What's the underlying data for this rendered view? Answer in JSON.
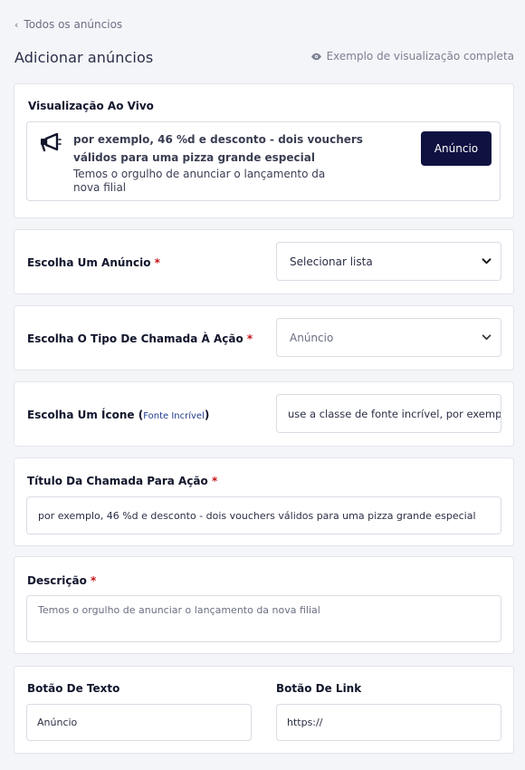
{
  "nav": {
    "back_label": "Todos os anúncios"
  },
  "header": {
    "title": "Adicionar anúncios",
    "preview_link": "Exemplo de visualização completa"
  },
  "live_preview": {
    "title": "Visualização Ao Vivo",
    "headline": "por exemplo, 46 %d e desconto - dois vouchers válidos para uma pizza grande especial",
    "description": "Temos o orgulho de anunciar o lançamento da nova filial",
    "button_label": "Anúncio"
  },
  "form": {
    "required_mark": "*",
    "announcement": {
      "label": "Escolha Um Anúncio",
      "value": "Selecionar lista"
    },
    "cta_type": {
      "label": "Escolha O Tipo De Chamada À Ação",
      "value": "Anúncio"
    },
    "icon": {
      "label": "Escolha Um Ícone",
      "link_open": "(",
      "link_text": "Fonte Incrível",
      "link_close": ")",
      "value": "use a classe de fonte incrível, por exemplo"
    },
    "cta_title": {
      "label": "Título Da Chamada Para Ação",
      "value": "por exemplo, 46 %d e desconto - dois vouchers válidos para uma pizza grande especial"
    },
    "description": {
      "label": "Descrição",
      "placeholder": "Temos o orgulho de anunciar o lançamento da nova filial"
    },
    "button_text": {
      "label": "Botão De Texto",
      "value": "Anúncio"
    },
    "button_link": {
      "label": "Botão De Link",
      "value": "https://"
    }
  },
  "colors": {
    "primary_button": "#0f1241",
    "required": "#c3141b",
    "link": "#1f3a8c"
  },
  "icons": {
    "back": "chevron-left-icon",
    "preview": "eye-icon",
    "live": "megaphone-icon",
    "select": "chevron-down-icon"
  }
}
